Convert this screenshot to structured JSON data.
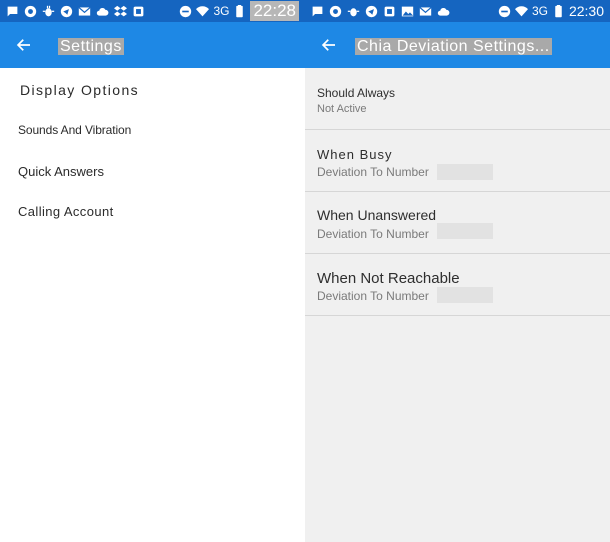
{
  "colors": {
    "status_bar": "#1565c0",
    "app_bar": "#1e88e5",
    "left_background": "#ffffff",
    "right_background": "#f0f0f0",
    "divider": "#d6d6d6",
    "primary_text": "#2e2e2e",
    "secondary_text": "#7a7a7a"
  },
  "left": {
    "status_bar": {
      "icons": [
        "message-icon",
        "chrome-icon",
        "bug-icon",
        "telegram-icon",
        "gmail-icon",
        "cloud-icon",
        "dropbox-icon",
        "app-icon"
      ],
      "right_icons": [
        "do-not-disturb-icon",
        "wifi-icon"
      ],
      "network": "3G",
      "battery_icon": "battery-icon",
      "time": "22:28"
    },
    "app_bar": {
      "back_icon": "arrow-back-icon",
      "title": "Settings"
    },
    "menu": [
      {
        "label": "Display Options"
      },
      {
        "label": "Sounds And Vibration"
      },
      {
        "label": "Quick Answers"
      },
      {
        "label": "Calling Account"
      }
    ]
  },
  "right": {
    "status_bar": {
      "icons": [
        "message-icon",
        "chrome-icon",
        "bug-icon",
        "telegram-icon",
        "app-icon",
        "image-icon",
        "gmail-icon",
        "cloud-icon"
      ],
      "right_icons": [
        "do-not-disturb-icon",
        "wifi-icon"
      ],
      "network": "3G",
      "battery_icon": "battery-icon",
      "time": "22:30"
    },
    "app_bar": {
      "back_icon": "arrow-back-icon",
      "title": "Chia Deviation Settings..."
    },
    "prefs": [
      {
        "title": "Should Always",
        "summary": "Not Active"
      },
      {
        "title": "When Busy",
        "summary": "Deviation To Number"
      },
      {
        "title": "When Unanswered",
        "summary": "Deviation To Number"
      },
      {
        "title": "When Not Reachable",
        "summary": "Deviation To Number"
      }
    ]
  }
}
